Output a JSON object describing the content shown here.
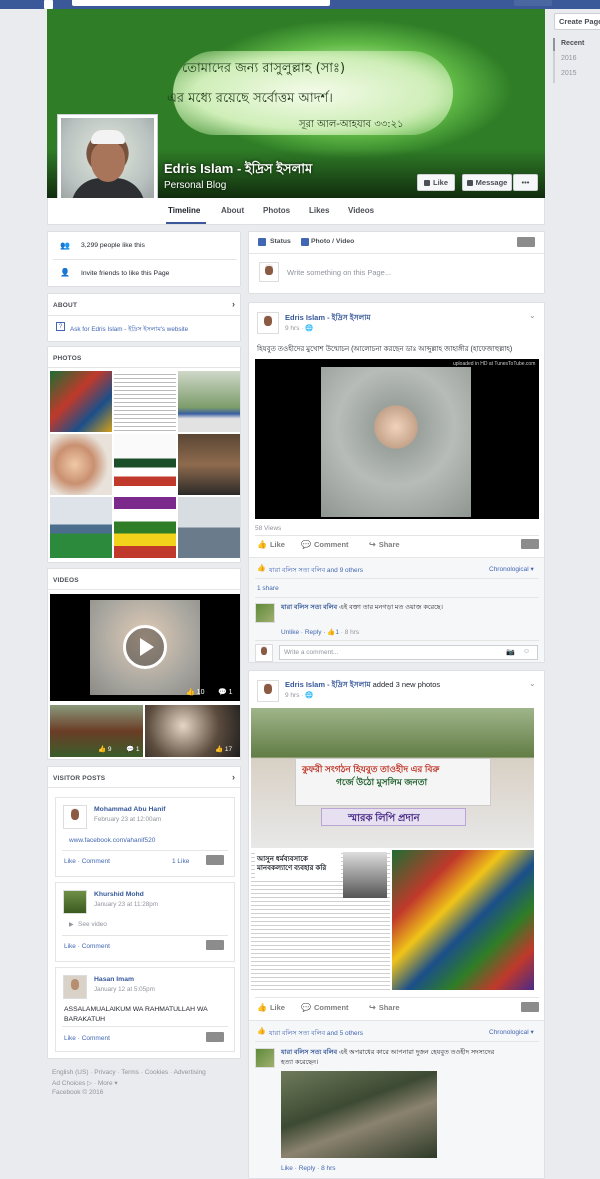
{
  "topbar": {
    "right_button_label": ""
  },
  "right_rail": {
    "create_page": "Create Page",
    "years": [
      "Recent",
      "2016",
      "2015"
    ]
  },
  "cover": {
    "bangla_line1": "তোমাদের জন্য রাসুলুল্লাহ (সাঃ)",
    "bangla_line2": "এর মধ্যে রয়েছে সর্বোত্তম আদর্শ।",
    "bangla_line3": "সূরা আল-আহযাব ৩৩:২১",
    "page_name": "Edris Islam - ইদ্রিস ইসলাম",
    "category": "Personal Blog",
    "like_button": "Like",
    "message_button": "Message",
    "more_button": "•••"
  },
  "tabs": [
    "Timeline",
    "About",
    "Photos",
    "Likes",
    "Videos"
  ],
  "left": {
    "likes_count": "3,299 people like this",
    "invite": "Invite friends to like this Page",
    "about": {
      "heading": "ABOUT",
      "link": "Ask for Edris Islam - ইদ্রিস ইসলাম's website"
    },
    "photos": {
      "heading": "PHOTOS"
    },
    "videos": {
      "heading": "VIDEOS",
      "main_likes": "10",
      "main_comments": "1",
      "thumb1_likes": "9",
      "thumb1_comments": "1",
      "thumb2_likes": "17"
    },
    "visitor_posts": {
      "heading": "VISITOR POSTS",
      "posts": [
        {
          "name": "Mohammad Abu Hanif",
          "time": "February 23 at 12:00am",
          "body": "www.facebook.com/ahanif520",
          "actions": "Like · Comment",
          "like_count": "1 Like"
        },
        {
          "name": "Khurshid Mohd",
          "time": "January 23 at 11:28pm",
          "body": "See video",
          "actions": "Like · Comment",
          "like_count": ""
        },
        {
          "name": "Hasan Imam",
          "time": "January 12 at 5:05pm",
          "body": "ASSALAMUALAIKUM WA RAHMATULLAH WA BARAKATUH",
          "actions": "Like · Comment",
          "like_count": ""
        }
      ]
    },
    "footer": {
      "line1": "English (US) · Privacy · Terms · Cookies · Advertising",
      "line2": "Ad Choices ▷ · More ▾",
      "line3": "Facebook © 2016"
    }
  },
  "composer": {
    "status_tab": "Status",
    "photo_tab": "Photo / Video",
    "placeholder": "Write something on this Page..."
  },
  "post1": {
    "author": "Edris Islam - ইদ্রিস ইসলাম",
    "time": "9 hrs · ",
    "text": "হিযবুত তওহীদের মুখোশ উন্মোচন (আলোচনা করছেন ডাঃ আব্দুল্লাহ জাহাঙ্গীর (হাফেজাহুল্লাহ)",
    "video_watermark": "uploaded in HD at TunesToTube.com",
    "views": "58 Views",
    "like": "Like",
    "comment": "Comment",
    "share": "Share",
    "reactors": "যারা বলিস সত্য বলিব and 9 others",
    "chronological": "Chronological ▾",
    "shares": "1 share",
    "comment_author": "যারা বলিস সত্য বলিব",
    "comment_text": "এই বক্তা তার মনগড়া মত ওয়াজ করেছে।",
    "comment_actions": "Unlike · Reply · ",
    "comment_likes": "1",
    "comment_time": " · 8 hrs",
    "write_comment": "Write a comment..."
  },
  "post2": {
    "author": "Edris Islam - ইদ্রিস ইসলাম",
    "added": " added 3 new photos",
    "time": "9 hrs · ",
    "banner_line1": "কুফরী সংগঠন হিযবুত তাওহীদ এর বিরু",
    "banner_line2": "গর্জে উঠো মুসলিম জনতা",
    "banner_line3": "স্মারক লিপি প্রদান",
    "doc_title": "আসুন ধর্মব্যবসাকে মানবকল্যাণে ব্যবহার করি",
    "like": "Like",
    "comment": "Comment",
    "share": "Share",
    "reactors": "যারা বলিস সত্য বলিব and 5 others",
    "chronological": "Chronological ▾",
    "comment_author": "যারা বলিস সত্য বলিব",
    "comment_text": "এই অপরাধের কারে আপনারা দুজন হেযবুত তওহীদ সদস্যদের হত্যা করেছেন।",
    "comment_actions": "Like · Reply · 8 hrs"
  },
  "colors": {
    "brand": "#3b5998",
    "link": "#365899",
    "bg": "#e9ebee"
  }
}
